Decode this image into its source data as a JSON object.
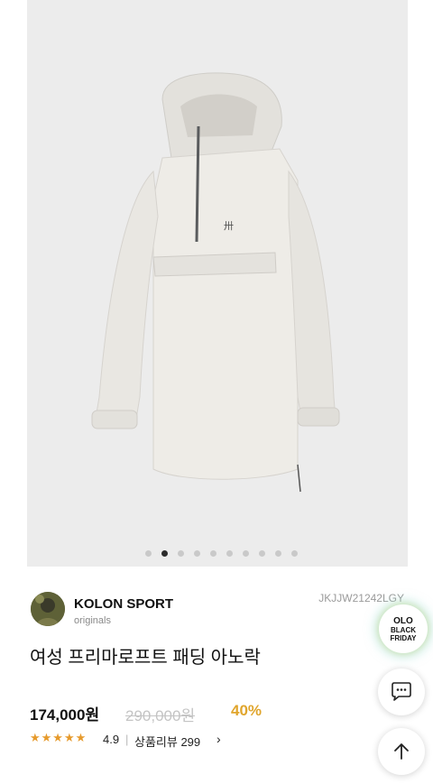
{
  "carousel": {
    "total": 10,
    "active": 1
  },
  "seller": {
    "brand": "KOLON SPORT",
    "sub": "originals",
    "sku": "JKJJW21242LGY"
  },
  "product": {
    "title": "여성 프리마로프트 패딩 아노락",
    "price": "174,000원",
    "original_price": "290,000원",
    "discount": "40%",
    "stars": "★★★★★",
    "rating": "4.9",
    "separator": "|",
    "reviews": "상품리뷰 299",
    "reviews_chevron": "›"
  },
  "badge": {
    "line1": "OLO",
    "line2": "BLACK",
    "line3": "FRIDAY"
  },
  "icons": {
    "chat": "chat-bubble-icon",
    "top": "arrow-up-icon"
  },
  "colors": {
    "discount": "#e0a52c",
    "stars": "#e69a2c"
  }
}
